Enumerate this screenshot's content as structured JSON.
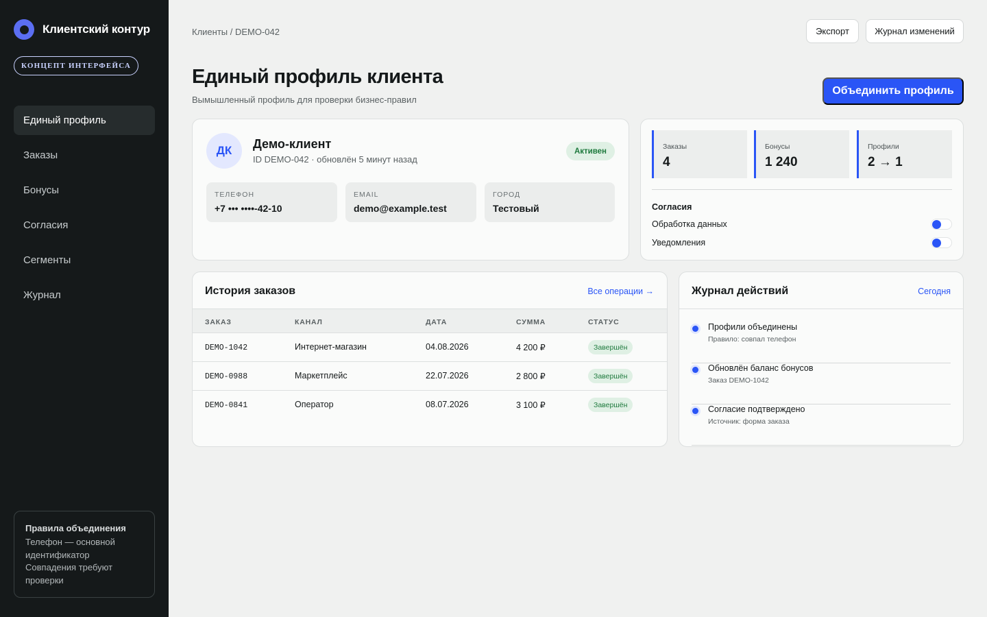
{
  "app": {
    "brand_name": "Клиентский контур",
    "concept_badge": "КОНЦЕПТ ИНТЕРФЕЙСА"
  },
  "sidebar": {
    "items": [
      {
        "label": "Единый профиль",
        "active": true
      },
      {
        "label": "Заказы"
      },
      {
        "label": "Бонусы"
      },
      {
        "label": "Согласия"
      },
      {
        "label": "Сегменты"
      },
      {
        "label": "Журнал"
      }
    ],
    "rules": {
      "title": "Правила объединения",
      "line1": "Телефон — основной идентификатор",
      "line2": "Совпадения требуют проверки"
    }
  },
  "header": {
    "breadcrumb": "Клиенты / DEMO-042",
    "export_label": "Экспорт",
    "journal_label": "Журнал изменений",
    "title": "Единый профиль клиента",
    "subtitle": "Вымышленный профиль для проверки бизнес-правил",
    "merge_label": "Объединить профиль"
  },
  "profile": {
    "initials": "ДК",
    "name": "Демо-клиент",
    "meta": "ID DEMO-042 · обновлён 5 минут назад",
    "status": "Активен",
    "fields": [
      {
        "label": "ТЕЛЕФОН",
        "value": "+7 ••• ••••-42-10"
      },
      {
        "label": "EMAIL",
        "value": "demo@example.test"
      },
      {
        "label": "ГОРОД",
        "value": "Тестовый"
      }
    ]
  },
  "stats": {
    "items": [
      {
        "label": "Заказы",
        "value": "4"
      },
      {
        "label": "Бонусы",
        "value": "1 240"
      },
      {
        "label": "Профили",
        "value": "2 → 1"
      }
    ],
    "consents_title": "Согласия",
    "consents": [
      {
        "label": "Обработка данных",
        "enabled": true
      },
      {
        "label": "Уведомления",
        "enabled": true
      }
    ]
  },
  "orders": {
    "title": "История заказов",
    "link": "Все операции →",
    "columns": [
      "ЗАКАЗ",
      "КАНАЛ",
      "ДАТА",
      "СУММА",
      "СТАТУС"
    ],
    "rows": [
      {
        "id": "DEMO-1042",
        "channel": "Интернет-магазин",
        "date": "04.08.2026",
        "amount": "4 200 ₽",
        "status": "Завершён"
      },
      {
        "id": "DEMO-0988",
        "channel": "Маркетплейс",
        "date": "22.07.2026",
        "amount": "2 800 ₽",
        "status": "Завершён"
      },
      {
        "id": "DEMO-0841",
        "channel": "Оператор",
        "date": "08.07.2026",
        "amount": "3 100 ₽",
        "status": "Завершён"
      }
    ]
  },
  "journal": {
    "title": "Журнал действий",
    "filter": "Сегодня",
    "events": [
      {
        "title": "Профили объединены",
        "sub": "Правило: совпал телефон"
      },
      {
        "title": "Обновлён баланс бонусов",
        "sub": "Заказ DEMO-1042"
      },
      {
        "title": "Согласие подтверждено",
        "sub": "Источник: форма заказа"
      }
    ]
  },
  "colors": {
    "accent": "#2a55f6",
    "sidebar_bg": "#15191a",
    "success_bg": "#dff0e4",
    "success_text": "#1e7a3d"
  }
}
